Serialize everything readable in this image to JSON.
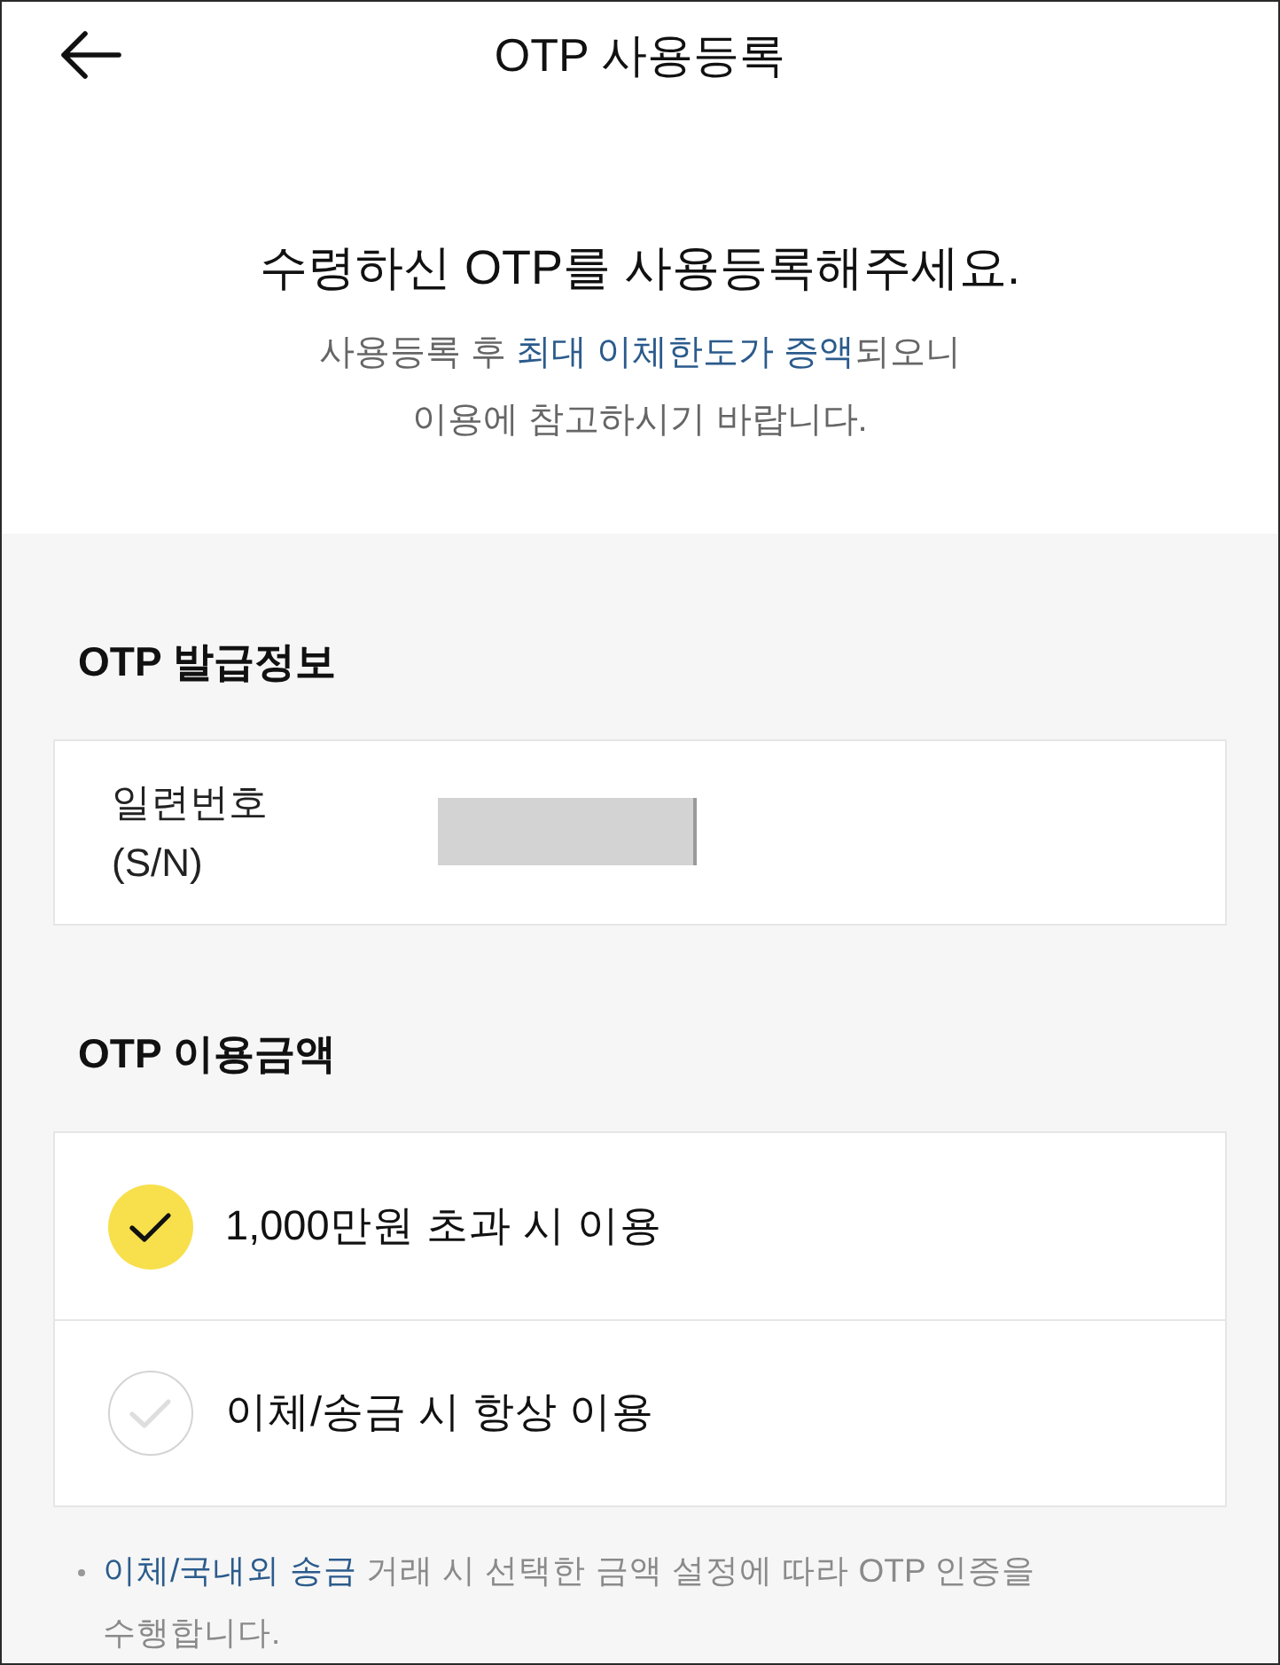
{
  "header": {
    "title": "OTP 사용등록"
  },
  "intro": {
    "headline": "수령하신 OTP를 사용등록해주세요.",
    "lines": [
      [
        {
          "text": "사용등록 후 ",
          "highlight": false
        },
        {
          "text": "최대 이체한도가 증액",
          "highlight": true
        },
        {
          "text": "되오니",
          "highlight": false
        }
      ],
      [
        {
          "text": "이용에 참고하시기 바랍니다.",
          "highlight": false
        }
      ]
    ]
  },
  "issue_info": {
    "title": "OTP 발급정보",
    "label_lines": [
      "일련번호",
      "(S/N)"
    ]
  },
  "usage": {
    "title": "OTP 이용금액",
    "options": [
      {
        "label": "1,000만원 초과 시 이용",
        "selected": true
      },
      {
        "label": "이체/송금 시 항상 이용",
        "selected": false
      }
    ]
  },
  "note": {
    "lines": [
      [
        {
          "text": "이체/국내외 송금",
          "highlight": true
        },
        {
          "text": " 거래 시 선택한 금액 설정에 따라 OTP 인증을",
          "highlight": false
        }
      ],
      [
        {
          "text": "수행합니다.",
          "highlight": false
        }
      ]
    ]
  }
}
